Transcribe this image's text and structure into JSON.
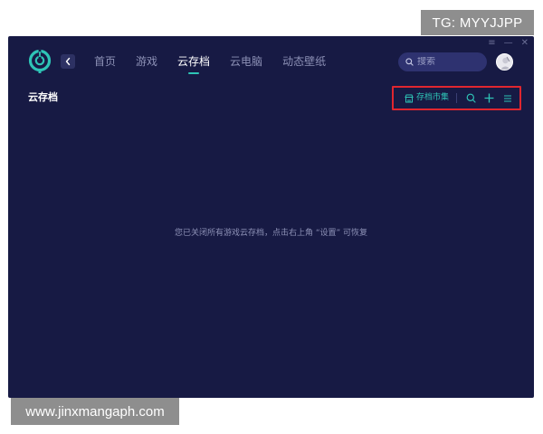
{
  "overlay": {
    "tg_badge": "TG: MYYJJPP",
    "watermark": "www.jinxmangaph.com"
  },
  "window": {
    "controls": [
      "≡",
      "—",
      "✕"
    ]
  },
  "nav": {
    "back_icon": "chevron-left-icon",
    "items": [
      {
        "label": "首页",
        "active": false
      },
      {
        "label": "游戏",
        "active": false
      },
      {
        "label": "云存档",
        "active": true
      },
      {
        "label": "云电脑",
        "active": false
      },
      {
        "label": "动态壁纸",
        "active": false
      }
    ]
  },
  "search": {
    "placeholder": "搜索",
    "value": ""
  },
  "section": {
    "title": "云存档"
  },
  "toolbar": {
    "store_label": "存档市集",
    "icons": [
      "store-icon",
      "search-icon",
      "plus-icon",
      "menu-icon"
    ]
  },
  "main": {
    "empty_message": "您已关闭所有游戏云存档，点击右上角 “设置” 可恢复"
  },
  "colors": {
    "background": "#171a44",
    "accent": "#2ec4b6",
    "highlight_border": "#e0262f",
    "muted_text": "#8d91b6"
  }
}
